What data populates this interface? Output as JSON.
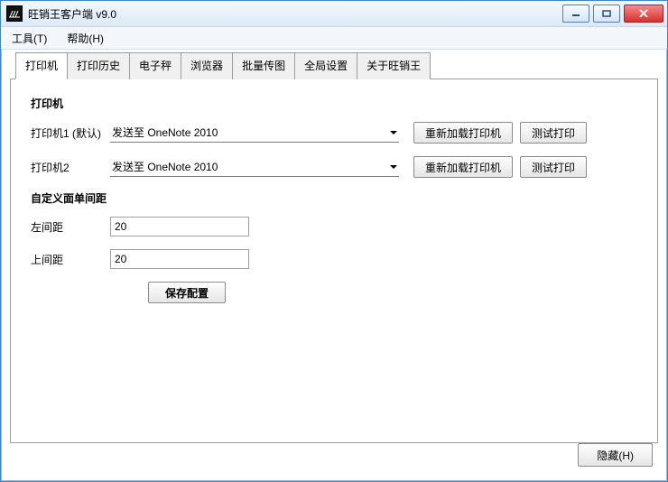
{
  "window": {
    "title": "旺销王客户端 v9.0"
  },
  "menu": {
    "tools": "工具(T)",
    "help": "帮助(H)"
  },
  "tabs": [
    {
      "id": "printer",
      "label": "打印机",
      "active": true
    },
    {
      "id": "history",
      "label": "打印历史"
    },
    {
      "id": "scale",
      "label": "电子秤"
    },
    {
      "id": "browser",
      "label": "浏览器"
    },
    {
      "id": "batch",
      "label": "批量传图"
    },
    {
      "id": "global",
      "label": "全局设置"
    },
    {
      "id": "about",
      "label": "关于旺销王"
    }
  ],
  "printer_panel": {
    "section1_title": "打印机",
    "printer1_label": "打印机1 (默认)",
    "printer1_value": "发送至 OneNote 2010",
    "printer2_label": "打印机2",
    "printer2_value": "发送至 OneNote 2010",
    "reload_label": "重新加载打印机",
    "test_label": "测试打印",
    "section2_title": "自定义面单间距",
    "left_margin_label": "左间距",
    "left_margin_value": "20",
    "top_margin_label": "上间距",
    "top_margin_value": "20",
    "save_label": "保存配置"
  },
  "footer": {
    "hide_label": "隐藏(H)"
  }
}
